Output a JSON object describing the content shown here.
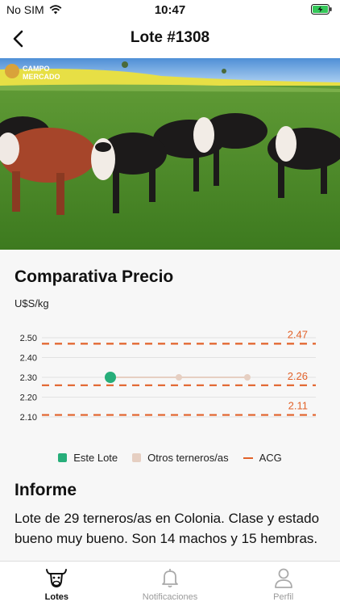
{
  "status_bar": {
    "carrier": "No SIM",
    "time": "10:47"
  },
  "nav": {
    "title": "Lote #1308"
  },
  "photo": {
    "logo_line1": "CAMPO",
    "logo_line2": "MERCADO"
  },
  "price_section": {
    "title": "Comparativa Precio",
    "unit": "U$S/kg"
  },
  "chart_data": {
    "type": "line",
    "title": "Comparativa Precio",
    "ylabel": "U$S/kg",
    "yticks": [
      "2.50",
      "2.40",
      "2.30",
      "2.20",
      "2.10"
    ],
    "ylim": [
      2.1,
      2.5
    ],
    "reference_lines": [
      {
        "name": "ACG",
        "value": 2.47,
        "label": "2.47"
      },
      {
        "name": "ACG",
        "value": 2.26,
        "label": "2.26"
      },
      {
        "name": "ACG",
        "value": 2.11,
        "label": "2.11"
      }
    ],
    "series": [
      {
        "name": "Este Lote",
        "points": [
          2.3
        ]
      },
      {
        "name": "Otros terneros/as",
        "points": [
          2.3,
          2.3
        ]
      }
    ],
    "legend": [
      "Este Lote",
      "Otros terneros/as",
      "ACG"
    ],
    "legend_position": "bottom",
    "colors": {
      "este_lote": "#27ae7a",
      "otros": "#e6cfc2",
      "acg": "#e2622a"
    }
  },
  "report": {
    "title": "Informe",
    "text": "Lote de 29 terneros/as en Colonia. Clase y estado bueno muy bueno. Son 14 machos y 15 hembras."
  },
  "tabs": [
    {
      "label": "Lotes",
      "icon": "cow-icon",
      "active": true
    },
    {
      "label": "Notificaciones",
      "icon": "bell-icon",
      "active": false
    },
    {
      "label": "Perfil",
      "icon": "person-icon",
      "active": false
    }
  ]
}
